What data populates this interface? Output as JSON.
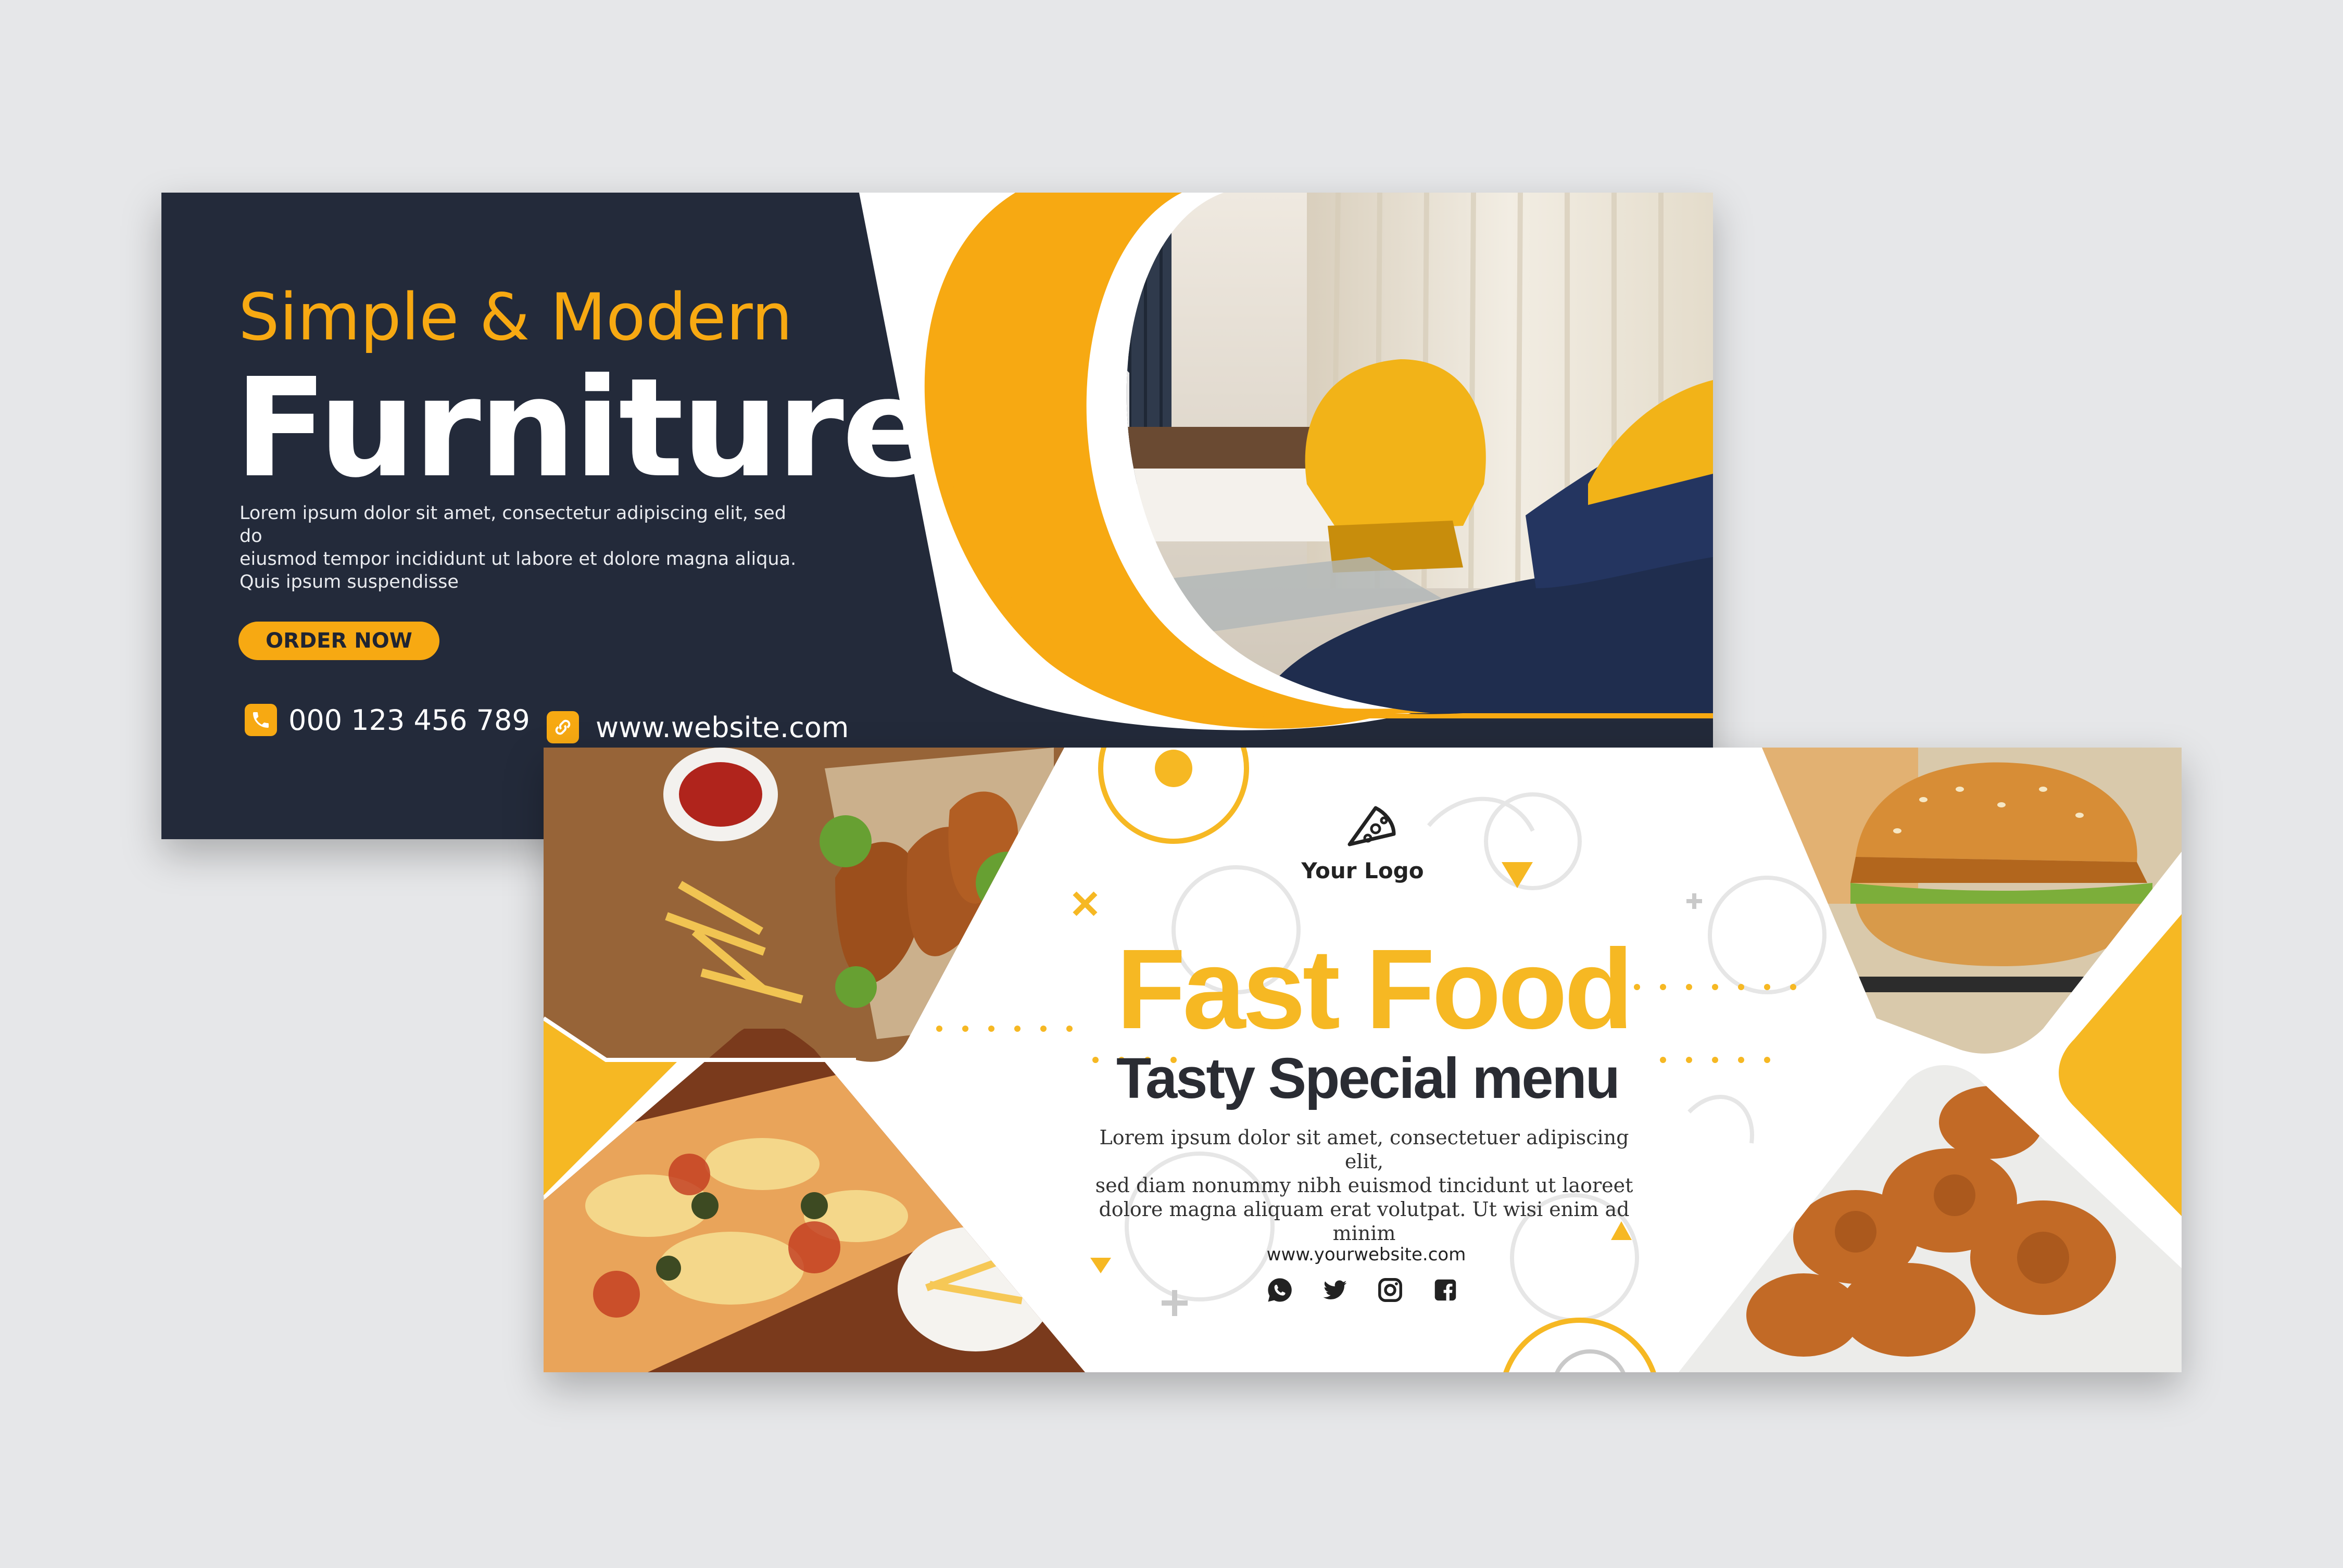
{
  "furniture_banner": {
    "subtitle": "Simple & Modern",
    "title": "Furniture",
    "body_lines": [
      "Lorem ipsum dolor sit amet, consectetur adipiscing elit, sed do",
      "eiusmod tempor incididunt ut labore et dolore magna aliqua.",
      "Quis ipsum suspendisse"
    ],
    "order_button": "ORDER NOW",
    "phone": "000 123 456 789",
    "website": "www.website.com",
    "icons": {
      "phone": "phone-icon",
      "link": "link-icon"
    }
  },
  "food_banner": {
    "logo_text": "Your Logo",
    "title": "Fast Food",
    "subtitle": "Tasty Special menu",
    "body_lines": [
      "Lorem ipsum dolor sit amet, consectetuer adipiscing elit,",
      "sed diam nonummy nibh euismod tincidunt ut laoreet",
      "dolore magna aliquam erat volutpat. Ut wisi enim ad minim"
    ],
    "website": "www.yourwebsite.com",
    "social_icons": [
      "whatsapp-icon",
      "twitter-icon",
      "instagram-icon",
      "facebook-icon"
    ]
  },
  "colors": {
    "background": "#e6e7e9",
    "navy": "#232a3a",
    "accent_yellow": "#f7a912",
    "fastfood_yellow": "#f6b823",
    "dark_text": "#2a2c33"
  }
}
